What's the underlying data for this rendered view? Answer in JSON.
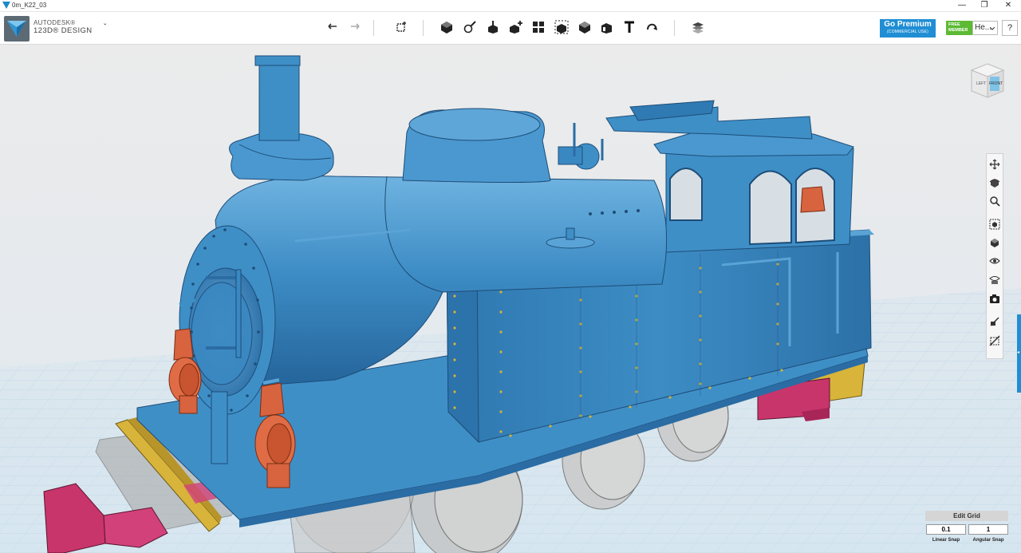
{
  "window": {
    "title": "0m_K22_03",
    "minimize_glyph": "—",
    "maximize_glyph": "❐",
    "close_glyph": "✕"
  },
  "brand": {
    "line1": "AUTODESK®",
    "line2": "123D® DESIGN",
    "menu_glyph": "ˇ"
  },
  "toolbar": {
    "icons": [
      "undo-icon",
      "redo-icon",
      "transform-icon",
      "primitives-icon",
      "sketch-icon",
      "construct-icon",
      "modify-icon",
      "pattern-icon",
      "group-icon",
      "combine-icon",
      "measure-icon",
      "text-icon",
      "snap-icon",
      "material-icon"
    ]
  },
  "account": {
    "premium_title": "Go Premium",
    "premium_sub": "(COMMERCIAL USE)",
    "badge_line1": "FREE",
    "badge_line2": "MEMBER",
    "user_label": "He...",
    "help_label": "?"
  },
  "viewcube": {
    "left_label": "LEFT",
    "front_label": "FRONT"
  },
  "nav_tools": [
    "pan-icon",
    "orbit-icon",
    "zoom-icon",
    "fit-icon",
    "view-icon",
    "visibility-icon",
    "materials-visibility-icon",
    "screenshot-icon",
    "snap-to-icon",
    "hide-sketch-icon"
  ],
  "grid": {
    "edit_label": "Edit Grid",
    "linear_value": "0.1",
    "angular_value": "1",
    "linear_label": "Linear Snap",
    "angular_label": "Angular Snap"
  },
  "colors": {
    "accent": "#1f8ed4",
    "model_blue": "#3f8fc7",
    "lamp_orange": "#d8633f",
    "buffer_pink": "#c8356b",
    "beam_yellow": "#d6b13c",
    "rivet_gold": "#d2b23a",
    "grid_bg": "#e4eef4"
  }
}
